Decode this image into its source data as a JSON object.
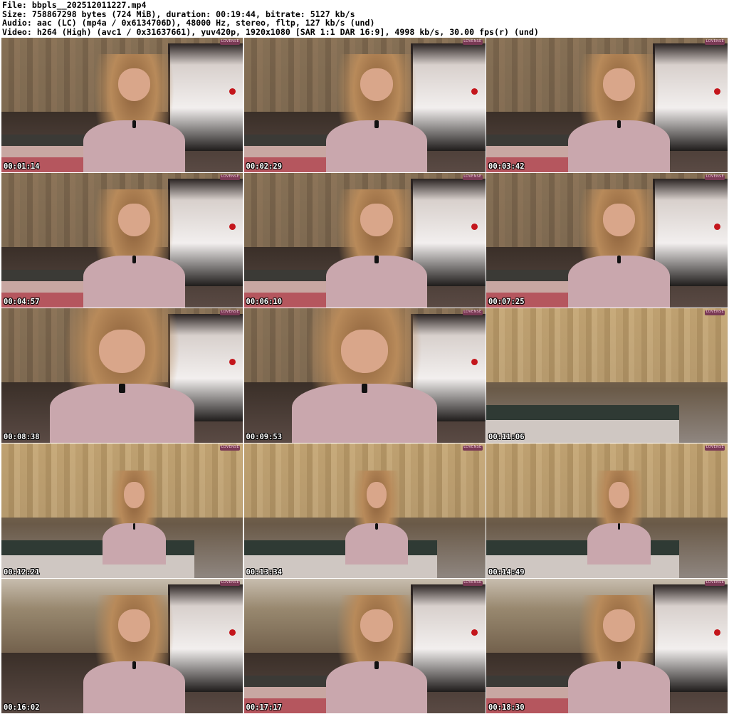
{
  "header": {
    "lines": [
      "File: bbpls__202512011227.mp4",
      "Size: 758867298 bytes (724 MiB), duration: 00:19:44, bitrate: 5127 kb/s",
      "Audio: aac (LC) (mp4a / 0x6134706D), 48000 Hz, stereo, fltp, 127 kb/s (und)",
      "Video: h264 (High) (avc1 / 0x31637661), yuv420p, 1920x1080 [SAR 1:1 DAR 16:9], 4998 kb/s, 30.00 fps(r) (und)"
    ]
  },
  "watermark": "LOVENSE",
  "thumbnails": [
    {
      "timestamp": "00:01:14"
    },
    {
      "timestamp": "00:02:29"
    },
    {
      "timestamp": "00:03:42"
    },
    {
      "timestamp": "00:04:57"
    },
    {
      "timestamp": "00:06:10"
    },
    {
      "timestamp": "00:07:25"
    },
    {
      "timestamp": "00:08:38"
    },
    {
      "timestamp": "00:09:53"
    },
    {
      "timestamp": "00:11:06"
    },
    {
      "timestamp": "00:12:21"
    },
    {
      "timestamp": "00:13:34"
    },
    {
      "timestamp": "00:14:49"
    },
    {
      "timestamp": "00:16:02"
    },
    {
      "timestamp": "00:17:17"
    },
    {
      "timestamp": "00:18:30"
    }
  ]
}
